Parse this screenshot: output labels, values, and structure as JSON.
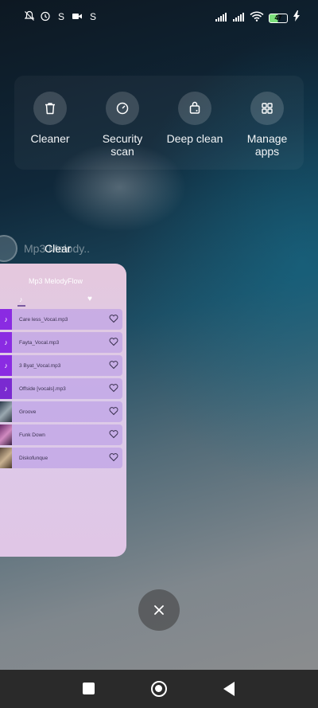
{
  "status_bar": {
    "left_icons": [
      "mute-bell-icon",
      "alarm-icon",
      "s-badge-icon",
      "video-call-icon",
      "s-badge-icon"
    ],
    "right_icons": [
      "signal-icon",
      "signal-icon",
      "wifi-icon",
      "battery-icon",
      "charging-icon"
    ],
    "battery_level": "47"
  },
  "quick_actions": [
    {
      "label": "Cleaner",
      "icon": "trash-icon"
    },
    {
      "label": "Security scan",
      "icon": "gauge-icon"
    },
    {
      "label": "Deep clean",
      "icon": "bag-clean-icon"
    },
    {
      "label": "Manage apps",
      "icon": "grid-icon"
    }
  ],
  "recent_app": {
    "name": "Mp3 MelodyFlow",
    "ghost_title": "Mp3 Melody..",
    "clear_label": "Clear",
    "card": {
      "title": "Mp3 MelodyFlow",
      "tabs": [
        "music-note-tab",
        "favorites-tab"
      ],
      "songs": [
        {
          "name": "Care less_Vocal.mp3",
          "thumb": "note"
        },
        {
          "name": "Fayta_Vocal.mp3",
          "thumb": "note"
        },
        {
          "name": "3 Byat_Vocal.mp3",
          "thumb": "note"
        },
        {
          "name": "Offside [vocals].mp3",
          "thumb": "note"
        },
        {
          "name": "Groove",
          "thumb": "image"
        },
        {
          "name": "Funk Down",
          "thumb": "image"
        },
        {
          "name": "Diskofunque",
          "thumb": "image"
        }
      ]
    }
  },
  "colors": {
    "accent_purple": "#8a2be2",
    "card_bg": "#dccbe9"
  }
}
